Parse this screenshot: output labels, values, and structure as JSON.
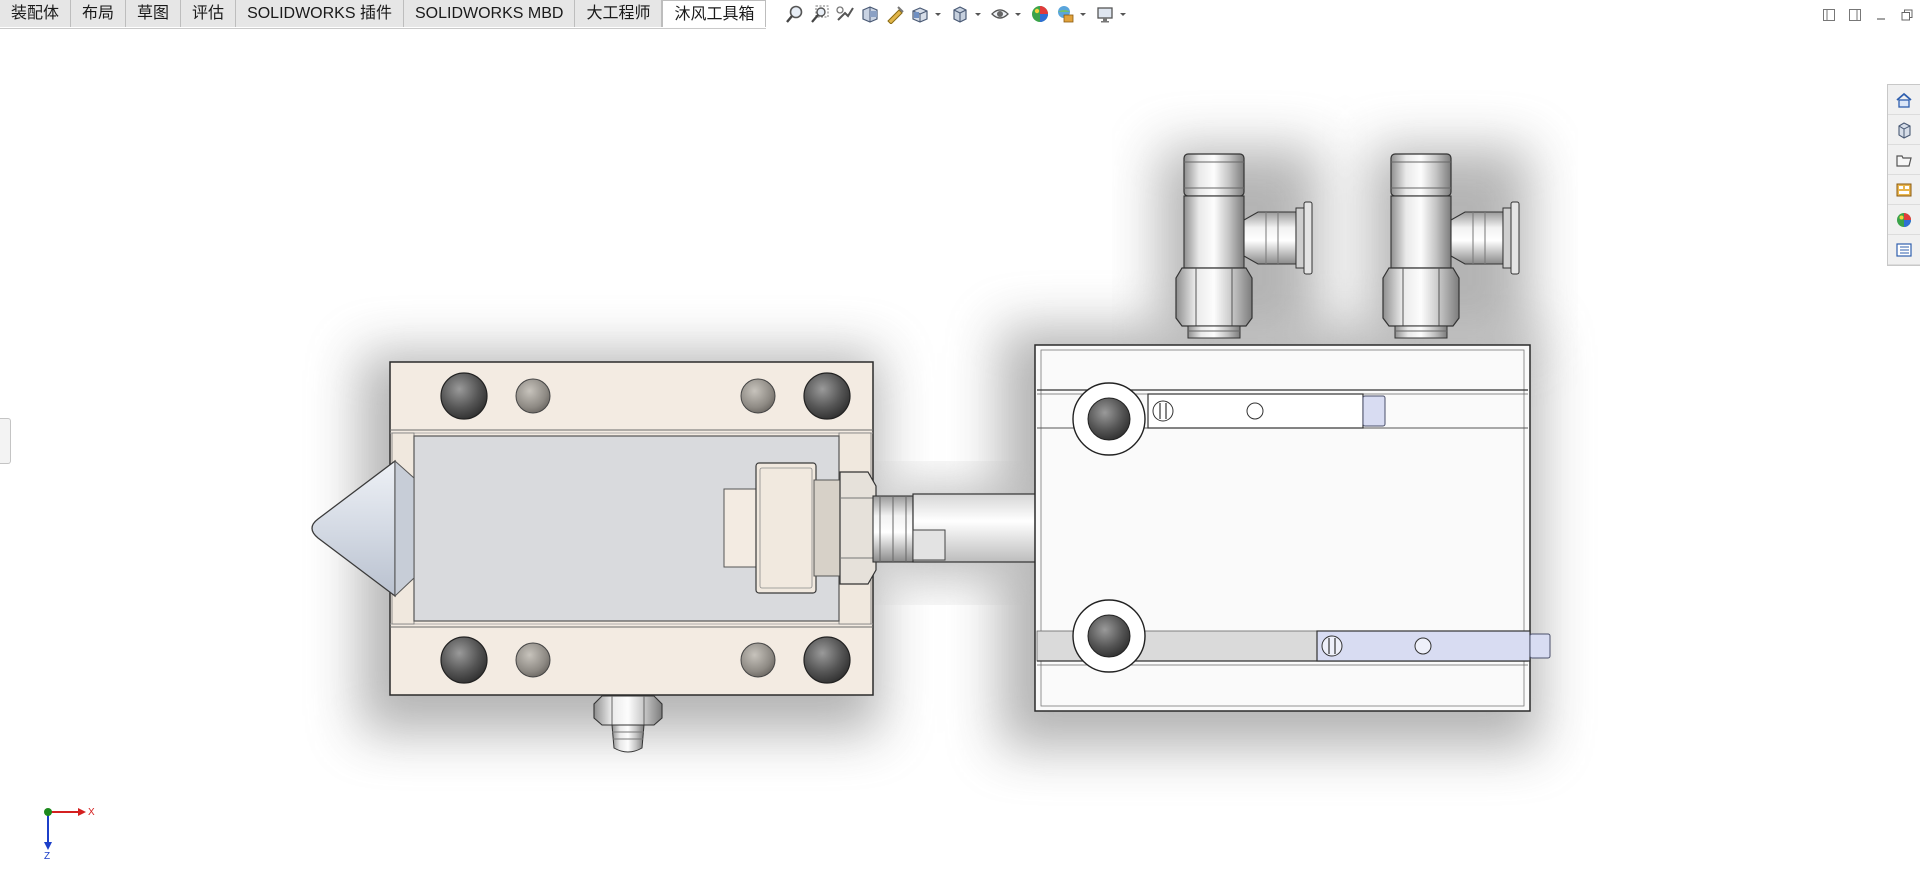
{
  "tabs": [
    {
      "label": "装配体"
    },
    {
      "label": "布局"
    },
    {
      "label": "草图"
    },
    {
      "label": "评估"
    },
    {
      "label": "SOLIDWORKS 插件"
    },
    {
      "label": "SOLIDWORKS MBD"
    },
    {
      "label": "大工程师"
    },
    {
      "label": "沐风工具箱"
    }
  ],
  "active_tab": "沐风工具箱",
  "hud_toolbar": [
    {
      "icon": "zoom-to-fit-icon"
    },
    {
      "icon": "zoom-to-area-icon"
    },
    {
      "icon": "previous-view-icon"
    },
    {
      "icon": "section-view-icon"
    },
    {
      "icon": "dynamic-annotation-icon"
    },
    {
      "icon": "view-orientation-icon"
    },
    {
      "icon": "display-style-icon"
    },
    {
      "icon": "hide-show-items-icon"
    },
    {
      "icon": "edit-appearance-icon"
    },
    {
      "icon": "apply-scene-icon"
    },
    {
      "icon": "view-settings-icon"
    }
  ],
  "window_controls": [
    "tile-left-icon",
    "tile-right-icon",
    "minimize-icon",
    "restore-icon"
  ],
  "task_pane": [
    {
      "icon": "solidworks-resources-icon"
    },
    {
      "icon": "design-library-icon"
    },
    {
      "icon": "file-explorer-icon"
    },
    {
      "icon": "view-palette-icon"
    },
    {
      "icon": "appearances-scenes-icon"
    },
    {
      "icon": "custom-properties-icon"
    }
  ],
  "triad": {
    "x_label": "X",
    "z_label": "Z"
  },
  "colors": {
    "tab_bg": "#e6e6e6",
    "active_tab_bg": "#ffffff",
    "block_face": "#f3ebe2",
    "cylinder_body": "#fafafa",
    "sensor_blue": "#d8dcf2",
    "triad_x": "#d42020",
    "triad_y": "#1d8a1d",
    "triad_z": "#1c3fc9"
  }
}
